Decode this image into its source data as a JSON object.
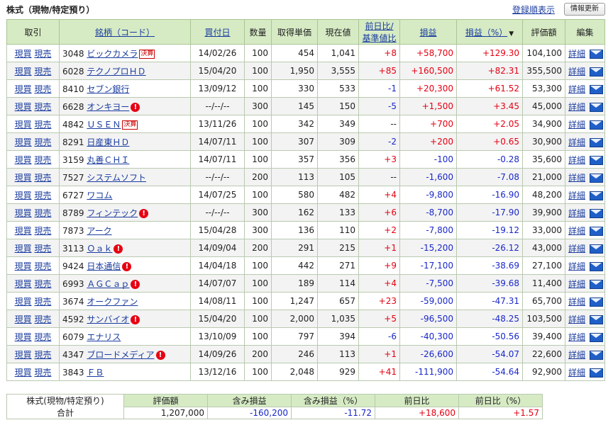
{
  "page": {
    "title": "株式（現物/特定預り）",
    "sort_link": "登録順表示",
    "refresh_button": "情報更新"
  },
  "headers": {
    "trade": "取引",
    "name": "銘柄（コード）",
    "date": "買付日",
    "qty": "数量",
    "cost": "取得単価",
    "price": "現在値",
    "change_line1": "前日比/",
    "change_line2": "基準値比",
    "pl": "損益",
    "plpct": "損益（%）",
    "sort_arrow": "▼",
    "value": "評価額",
    "edit": "編集"
  },
  "labels": {
    "buy": "現買",
    "sell": "現売",
    "detail": "詳細",
    "kessan": "決算",
    "alert": "!"
  },
  "colors": {
    "header_bg": "#d6ebc4",
    "positive": "#e60012",
    "negative": "#1a28c8",
    "link": "#1a3c9e"
  },
  "rows": [
    {
      "code": "3048",
      "name": "ビックカメラ",
      "badge": "kessan",
      "date": "14/02/26",
      "qty": "100",
      "cost": "454",
      "price": "1,041",
      "chg": "+8",
      "chg_s": "pos",
      "pl": "+58,700",
      "pl_s": "pos",
      "pct": "+129.30",
      "pct_s": "pos",
      "value": "104,100"
    },
    {
      "code": "6028",
      "name": "テクノプロＨＤ",
      "badge": "",
      "date": "15/04/20",
      "qty": "100",
      "cost": "1,950",
      "price": "3,555",
      "chg": "+85",
      "chg_s": "pos",
      "pl": "+160,500",
      "pl_s": "pos",
      "pct": "+82.31",
      "pct_s": "pos",
      "value": "355,500"
    },
    {
      "code": "8410",
      "name": "セブン銀行",
      "badge": "",
      "date": "13/09/12",
      "qty": "100",
      "cost": "330",
      "price": "533",
      "chg": "-1",
      "chg_s": "neg",
      "pl": "+20,300",
      "pl_s": "pos",
      "pct": "+61.52",
      "pct_s": "pos",
      "value": "53,300"
    },
    {
      "code": "6628",
      "name": "オンキヨー",
      "badge": "alert",
      "date": "--/--/--",
      "qty": "300",
      "cost": "145",
      "price": "150",
      "chg": "-5",
      "chg_s": "neg",
      "pl": "+1,500",
      "pl_s": "pos",
      "pct": "+3.45",
      "pct_s": "pos",
      "value": "45,000"
    },
    {
      "code": "4842",
      "name": "ＵＳＥＮ",
      "badge": "kessan",
      "date": "13/11/26",
      "qty": "100",
      "cost": "342",
      "price": "349",
      "chg": "--",
      "chg_s": "",
      "pl": "+700",
      "pl_s": "pos",
      "pct": "+2.05",
      "pct_s": "pos",
      "value": "34,900"
    },
    {
      "code": "8291",
      "name": "日産東ＨＤ",
      "badge": "",
      "date": "14/07/11",
      "qty": "100",
      "cost": "307",
      "price": "309",
      "chg": "-2",
      "chg_s": "neg",
      "pl": "+200",
      "pl_s": "pos",
      "pct": "+0.65",
      "pct_s": "pos",
      "value": "30,900"
    },
    {
      "code": "3159",
      "name": "丸善ＣＨＩ",
      "badge": "",
      "date": "14/07/11",
      "qty": "100",
      "cost": "357",
      "price": "356",
      "chg": "+3",
      "chg_s": "pos",
      "pl": "-100",
      "pl_s": "neg",
      "pct": "-0.28",
      "pct_s": "neg",
      "value": "35,600"
    },
    {
      "code": "7527",
      "name": "システムソフト",
      "badge": "",
      "date": "--/--/--",
      "qty": "200",
      "cost": "113",
      "price": "105",
      "chg": "--",
      "chg_s": "",
      "pl": "-1,600",
      "pl_s": "neg",
      "pct": "-7.08",
      "pct_s": "neg",
      "value": "21,000"
    },
    {
      "code": "6727",
      "name": "ワコム",
      "badge": "",
      "date": "14/07/25",
      "qty": "100",
      "cost": "580",
      "price": "482",
      "chg": "+4",
      "chg_s": "pos",
      "pl": "-9,800",
      "pl_s": "neg",
      "pct": "-16.90",
      "pct_s": "neg",
      "value": "48,200"
    },
    {
      "code": "8789",
      "name": "フィンテック",
      "badge": "alert",
      "date": "--/--/--",
      "qty": "300",
      "cost": "162",
      "price": "133",
      "chg": "+6",
      "chg_s": "pos",
      "pl": "-8,700",
      "pl_s": "neg",
      "pct": "-17.90",
      "pct_s": "neg",
      "value": "39,900"
    },
    {
      "code": "7873",
      "name": "アーク",
      "badge": "",
      "date": "15/04/28",
      "qty": "300",
      "cost": "136",
      "price": "110",
      "chg": "+2",
      "chg_s": "pos",
      "pl": "-7,800",
      "pl_s": "neg",
      "pct": "-19.12",
      "pct_s": "neg",
      "value": "33,000"
    },
    {
      "code": "3113",
      "name": "Ｏａｋ",
      "badge": "alert",
      "date": "14/09/04",
      "qty": "200",
      "cost": "291",
      "price": "215",
      "chg": "+1",
      "chg_s": "pos",
      "pl": "-15,200",
      "pl_s": "neg",
      "pct": "-26.12",
      "pct_s": "neg",
      "value": "43,000"
    },
    {
      "code": "9424",
      "name": "日本通信",
      "badge": "alert",
      "date": "14/04/18",
      "qty": "100",
      "cost": "442",
      "price": "271",
      "chg": "+9",
      "chg_s": "pos",
      "pl": "-17,100",
      "pl_s": "neg",
      "pct": "-38.69",
      "pct_s": "neg",
      "value": "27,100"
    },
    {
      "code": "6993",
      "name": "ＡＧＣａｐ",
      "badge": "alert",
      "date": "14/07/07",
      "qty": "100",
      "cost": "189",
      "price": "114",
      "chg": "+4",
      "chg_s": "pos",
      "pl": "-7,500",
      "pl_s": "neg",
      "pct": "-39.68",
      "pct_s": "neg",
      "value": "11,400"
    },
    {
      "code": "3674",
      "name": "オークファン",
      "badge": "",
      "date": "14/08/11",
      "qty": "100",
      "cost": "1,247",
      "price": "657",
      "chg": "+23",
      "chg_s": "pos",
      "pl": "-59,000",
      "pl_s": "neg",
      "pct": "-47.31",
      "pct_s": "neg",
      "value": "65,700"
    },
    {
      "code": "4592",
      "name": "サンバイオ",
      "badge": "alert",
      "date": "15/04/20",
      "qty": "100",
      "cost": "2,000",
      "price": "1,035",
      "chg": "+5",
      "chg_s": "pos",
      "pl": "-96,500",
      "pl_s": "neg",
      "pct": "-48.25",
      "pct_s": "neg",
      "value": "103,500"
    },
    {
      "code": "6079",
      "name": "エナリス",
      "badge": "",
      "date": "13/10/09",
      "qty": "100",
      "cost": "797",
      "price": "394",
      "chg": "-6",
      "chg_s": "neg",
      "pl": "-40,300",
      "pl_s": "neg",
      "pct": "-50.56",
      "pct_s": "neg",
      "value": "39,400"
    },
    {
      "code": "4347",
      "name": "ブロードメディア",
      "badge": "alert",
      "date": "14/09/26",
      "qty": "200",
      "cost": "246",
      "price": "113",
      "chg": "+1",
      "chg_s": "pos",
      "pl": "-26,600",
      "pl_s": "neg",
      "pct": "-54.07",
      "pct_s": "neg",
      "value": "22,600"
    },
    {
      "code": "3843",
      "name": "ＦＢ",
      "badge": "",
      "date": "13/12/16",
      "qty": "100",
      "cost": "2,048",
      "price": "929",
      "chg": "+41",
      "chg_s": "pos",
      "pl": "-111,900",
      "pl_s": "neg",
      "pct": "-54.64",
      "pct_s": "neg",
      "value": "92,900"
    }
  ],
  "summary": {
    "label_line1": "株式(現物/特定預り)",
    "label_line2": "合計",
    "h_value": "評価額",
    "h_pl": "含み損益",
    "h_plpct": "含み損益（%）",
    "h_chg": "前日比",
    "h_chgpct": "前日比（%）",
    "value": "1,207,000",
    "pl": "-160,200",
    "plpct": "-11.72",
    "chg": "+18,600",
    "chgpct": "+1.57"
  }
}
